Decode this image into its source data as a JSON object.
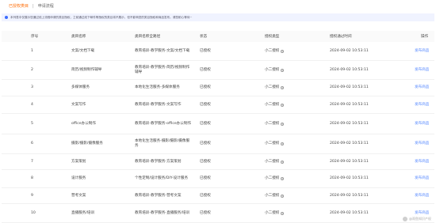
{
  "tabs": [
    {
      "label": "已授权类目",
      "active": true
    },
    {
      "label": "申请流程",
      "active": false
    }
  ],
  "tab_separator": "|",
  "notice": "本列表中仅展示您通过线上流程申请的类目授权，之前通过线下邮件等授权的类目将不展示，但不影响您的类目授权和商品发布。请您耐心等待~",
  "columns": [
    "序号",
    "类目名称",
    "类目名称全路径",
    "状态",
    "授权类型",
    "授权通过时间",
    "操作"
  ],
  "rows": [
    {
      "idx": "1",
      "name": "文案/文档下载",
      "path": "教育培训-教学服务-文案/文档下载",
      "status": "已授权",
      "type": "小二授权",
      "time": "2024-09-02 10:53:11",
      "action": "发布商品"
    },
    {
      "idx": "2",
      "name": "简历/视频制作辅导",
      "path": "教育培训-教学服务-简历/视频制作辅导",
      "status": "已授权",
      "type": "小二授权",
      "time": "2024-09-02 10:53:11",
      "action": "发布商品"
    },
    {
      "idx": "3",
      "name": "多媒体服务",
      "path": "本地化生活服务-多媒体服务",
      "status": "已授权",
      "type": "小二授权",
      "time": "2024-09-02 10:53:11",
      "action": "发布商品"
    },
    {
      "idx": "4",
      "name": "文案写作",
      "path": "教育培训-教学服务-文案写作",
      "status": "已授权",
      "type": "小二授权",
      "time": "2024-09-02 10:53:11",
      "action": "发布商品"
    },
    {
      "idx": "5",
      "name": "office办公制作",
      "path": "教育培训-教学服务-office办公制作",
      "status": "已授权",
      "type": "小二授权",
      "time": "2024-09-02 10:53:11",
      "action": "发布商品"
    },
    {
      "idx": "6",
      "name": "摄影/摄影/摄像服务",
      "path": "本地化生活服务-摄影/摄影/摄像服务",
      "status": "已授权",
      "type": "小二授权",
      "time": "2024-09-02 10:53:11",
      "action": "发布商品"
    },
    {
      "idx": "7",
      "name": "方案策划",
      "path": "教育培训-教学服务-方案策划",
      "status": "已授权",
      "type": "小二授权",
      "time": "2024-09-02 10:53:11",
      "action": "发布商品"
    },
    {
      "idx": "8",
      "name": "设计服务",
      "path": "个性定制/设计服务/DIY-设计服务",
      "status": "已授权",
      "type": "小二授权",
      "time": "2024-09-02 10:53:11",
      "action": "发布商品"
    },
    {
      "idx": "9",
      "name": "营考文案",
      "path": "教育培训-教学服务-营考文案",
      "status": "已授权",
      "type": "小二授权",
      "time": "2024-09-02 10:53:11",
      "action": "发布商品"
    },
    {
      "idx": "10",
      "name": "直播服务/培训",
      "path": "教育培训-教学服务-直播服务/培训",
      "status": "已授权",
      "type": "小二授权",
      "time": "2024-09-02 10:53:11",
      "action": "发布商品"
    }
  ],
  "watermark": "@雨鱼知识产权"
}
